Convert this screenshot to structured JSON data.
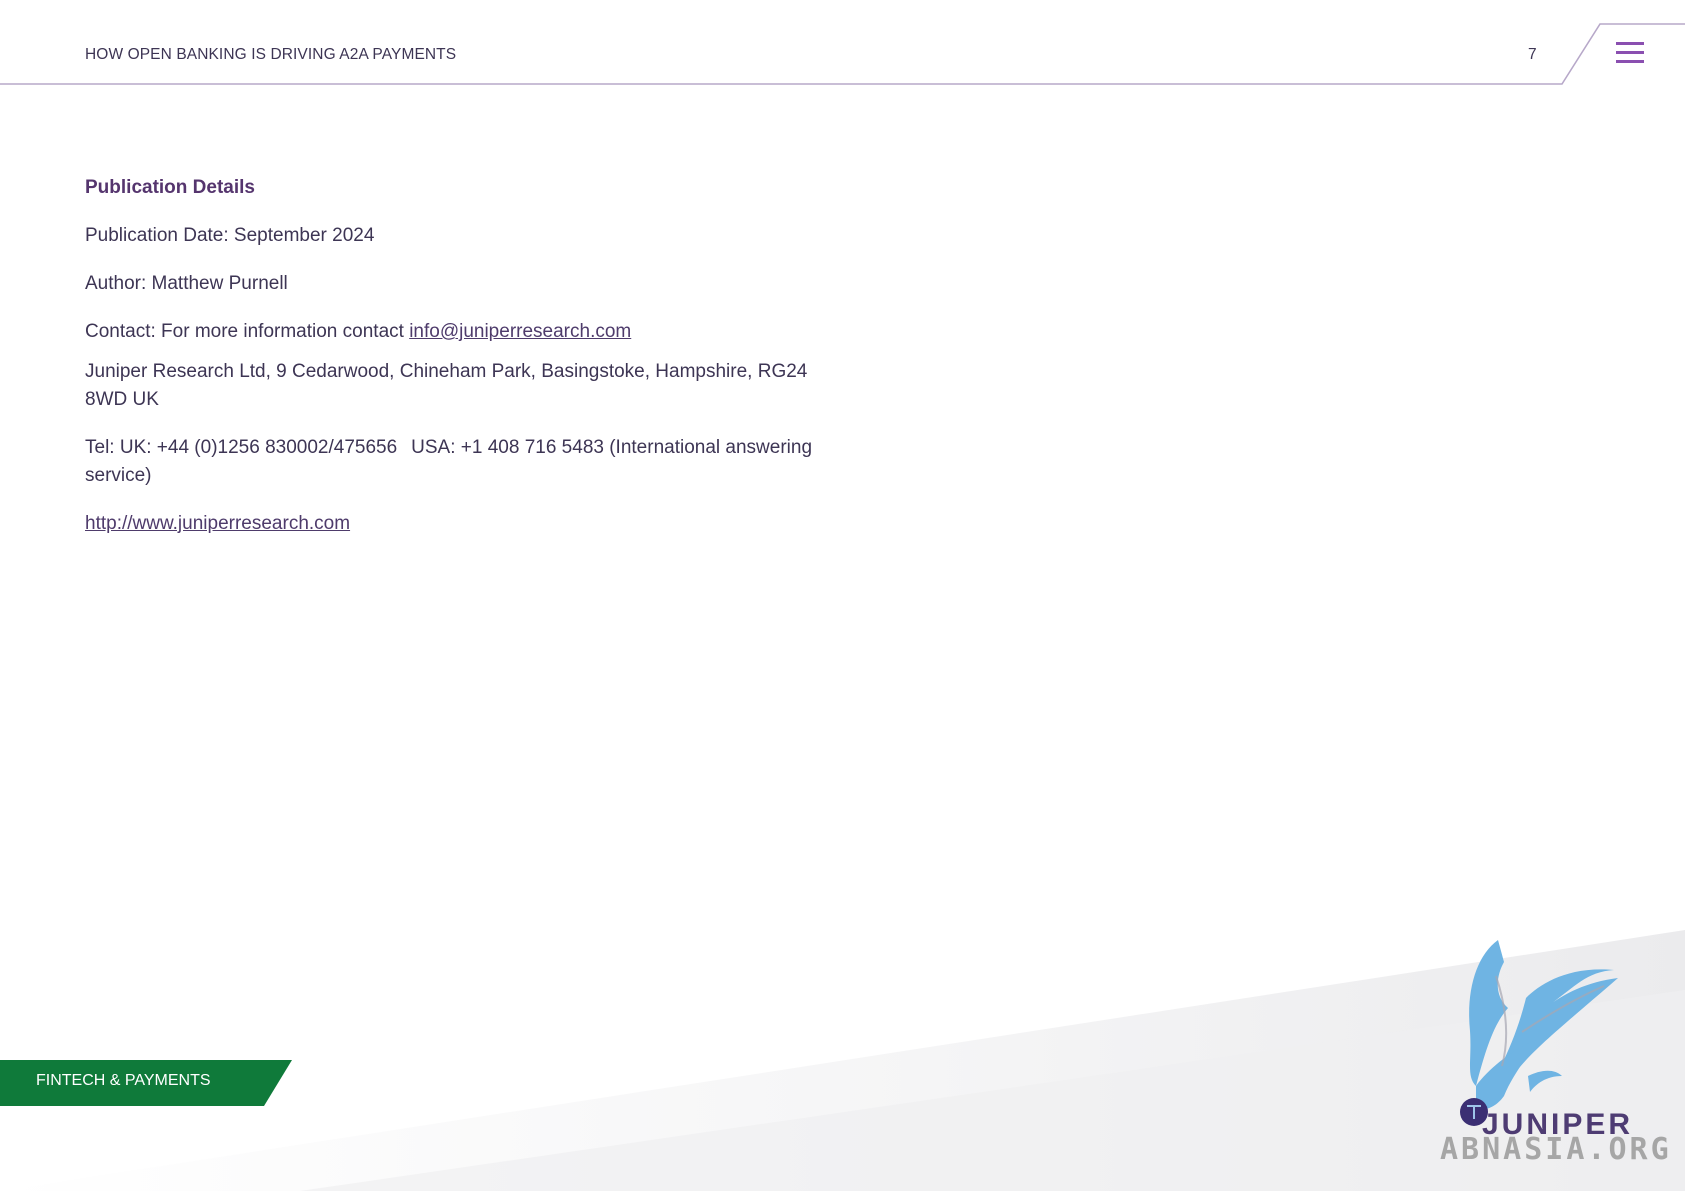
{
  "header": {
    "title": "HOW OPEN BANKING IS DRIVING A2A PAYMENTS",
    "page_number": "7",
    "menu_icon": "hamburger-menu-icon"
  },
  "publication": {
    "heading": "Publication Details",
    "date": "Publication Date: September 2024",
    "author": "Author: Matthew Purnell",
    "contact_prefix": "Contact: For more information contact ",
    "contact_email": "info@juniperresearch.com",
    "address": "Juniper Research Ltd, 9 Cedarwood, Chineham Park, Basingstoke, Hampshire, RG24 8WD UK",
    "tel_uk": "Tel: UK: +44 (0)1256 830002/475656",
    "tel_usa": "USA: +1 408 716 5483 (International answering service)",
    "website": "http://www.juniperresearch.com"
  },
  "footer": {
    "category": "FINTECH & PAYMENTS",
    "logo_text": "JUNIPER",
    "watermark_text": "ABNASIA.ORG"
  },
  "colors": {
    "brand_purple": "#55356e",
    "accent_purple": "#8a4fb0",
    "category_green": "#0f7a3a",
    "text": "#3d3554",
    "bird_blue": "#6fb4e3"
  }
}
